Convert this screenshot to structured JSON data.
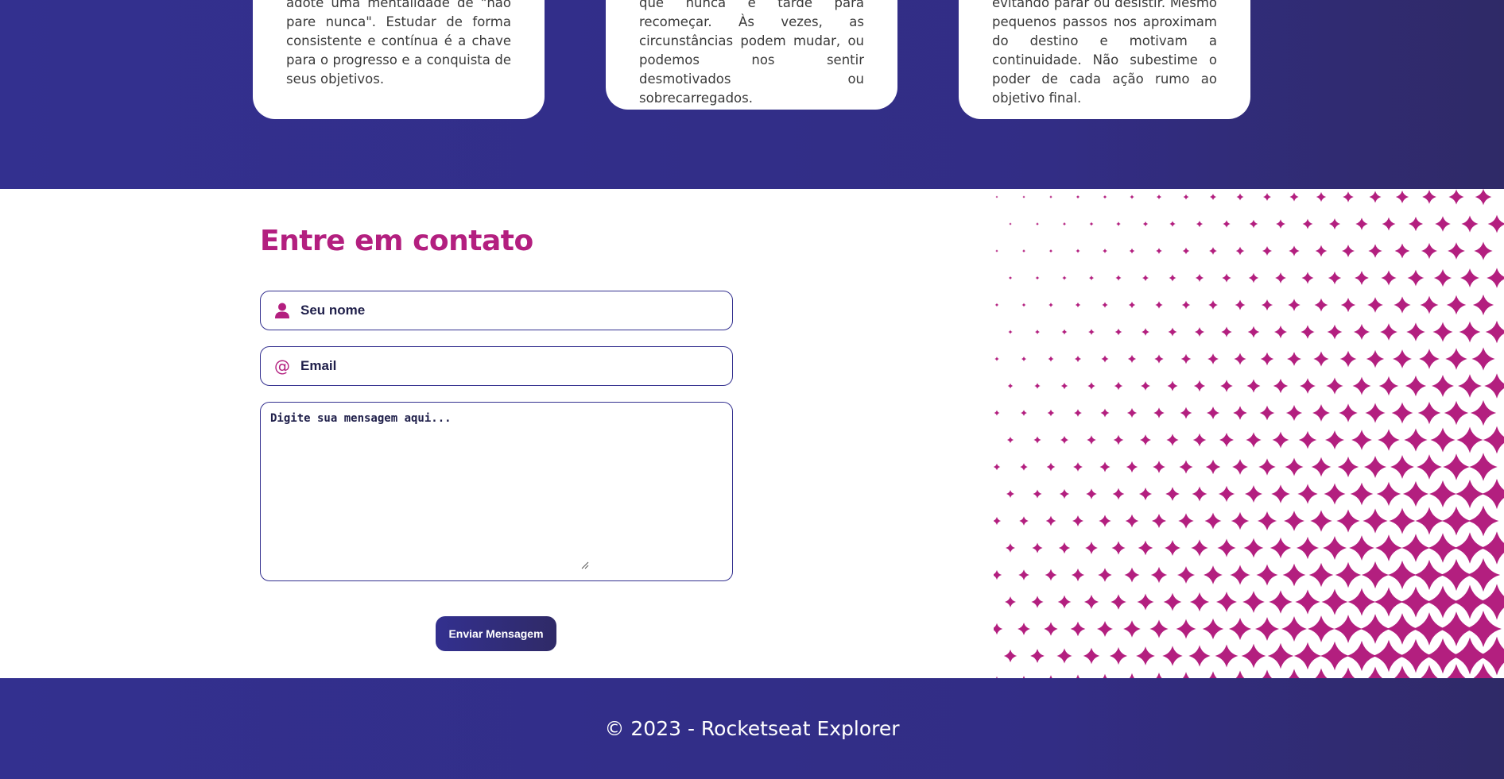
{
  "cards": [
    {
      "text": "adote uma mentalidade de \"não pare nunca\". Estudar de forma consistente e contínua é a chave para o progresso e a conquista de seus objetivos."
    },
    {
      "text": "que nunca é tarde para recomeçar. Às vezes, as circunstâncias podem mudar, ou podemos nos sentir desmotivados ou sobrecarregados."
    },
    {
      "text": "evitando parar ou desistir. Mesmo pequenos passos nos aproximam do destino e motivam a continuidade. Não subestime o poder de cada ação rumo ao objetivo final."
    }
  ],
  "contact": {
    "title": "Entre em contato",
    "name_placeholder": "Seu nome",
    "email_placeholder": "Email",
    "message_placeholder": "Digite sua mensagem aqui...",
    "submit_label": "Enviar Mensagem",
    "icons": {
      "name": "user-icon",
      "email": "at-sign-icon"
    }
  },
  "footer": {
    "text": "© 2023 - Rocketseat Explorer"
  },
  "colors": {
    "brand_purple": "#33308f",
    "brand_dark": "#2f2a67",
    "accent_pink": "#b31f7f",
    "text_dark": "#1f1f4a"
  }
}
